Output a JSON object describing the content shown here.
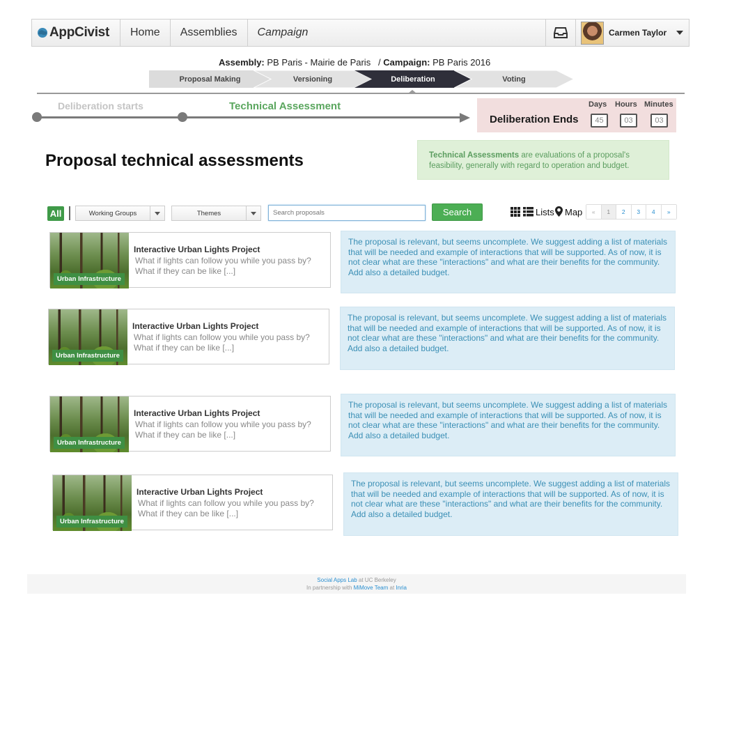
{
  "nav": {
    "logo": "AppCivist",
    "home": "Home",
    "assemblies": "Assemblies",
    "campaign": "Campaign",
    "user_name": "Carmen Taylor"
  },
  "context": {
    "assembly_label": "Assembly:",
    "assembly_value": "PB Paris - Mairie de Paris",
    "campaign_sep": "/",
    "campaign_label": "Campaign:",
    "campaign_value": "PB Paris 2016"
  },
  "stages": [
    {
      "label": "Proposal Making",
      "active": false
    },
    {
      "label": "Versioning",
      "active": false
    },
    {
      "label": "Deliberation",
      "active": true
    },
    {
      "label": "Voting",
      "active": false
    }
  ],
  "timeline": {
    "start_label": "Deliberation starts",
    "current_label": "Technical Assessment",
    "end_label": "Deliberation Ends",
    "countdown": {
      "days_label": "Days",
      "days": "45",
      "hours_label": "Hours",
      "hours": "03",
      "minutes_label": "Minutes",
      "minutes": "03"
    }
  },
  "page": {
    "title": "Proposal technical assessments",
    "info_bold": "Technical Assessments",
    "info_rest": " are evaluations of a proposal's feasibility, generally with regard to operation and budget."
  },
  "filters": {
    "all_label": "All",
    "working_groups": "Working Groups",
    "themes": "Themes",
    "search_placeholder": "Search proposals",
    "search_button": "Search",
    "lists_label": "Lists",
    "map_label": "Map",
    "pages": [
      "«",
      "1",
      "2",
      "3",
      "4",
      "»"
    ]
  },
  "proposals": [
    {
      "badge": "Urban Infrastructure",
      "title": "Interactive Urban Lights Project",
      "description": "What if lights can follow you while you pass by? What if they can be like [...]",
      "assessment": "The proposal is relevant, but seems uncomplete. We suggest adding a list of materials that will be needed and example of interactions that will be supported. As of now, it is not clear what are these \"interactions\" and what are their benefits for the community. Add also a detailed budget."
    },
    {
      "badge": "Urban Infrastructure",
      "title": "Interactive Urban Lights Project",
      "description": "What if lights can follow you while you pass by? What if they can be like [...]",
      "assessment": "The proposal is relevant, but seems uncomplete. We suggest adding a list of materials that will be needed and example of interactions that will be supported. As of now, it is not clear what are these \"interactions\" and what are their benefits for the community. Add also a detailed budget."
    },
    {
      "badge": "Urban Infrastructure",
      "title": "Interactive Urban Lights Project",
      "description": "What if lights can follow you while you pass by? What if they can be like [...]",
      "assessment": "The proposal is relevant, but seems uncomplete. We suggest adding a list of materials that will be needed and example of interactions that will be supported. As of now, it is not clear what are these \"interactions\" and what are their benefits for the community. Add also a detailed budget."
    },
    {
      "badge": "Urban Infrastructure",
      "title": "Interactive Urban Lights Project",
      "description": "What if lights can follow you while you pass by? What if they can be like [...]",
      "assessment": "The proposal is relevant, but seems uncomplete. We suggest adding a list of materials that will be needed and example of interactions that will be supported. As of now, it is not clear what are these \"interactions\" and what are their benefits for the community. Add also a detailed budget."
    }
  ],
  "footer": {
    "lab_link": "Social Apps Lab",
    "lab_rest": " at UC Berkeley",
    "partner_prefix": "In partnership with ",
    "team_link": "MiMove Team",
    "team_sep": " at ",
    "inria_link": "Inria"
  },
  "colors": {
    "active_stage": "#2f2f3a",
    "inactive_stage": "#e0e0e0",
    "accent_green": "#4cae54",
    "assessment_bg": "#dcedf6",
    "deadline_bg": "#f2dede"
  }
}
